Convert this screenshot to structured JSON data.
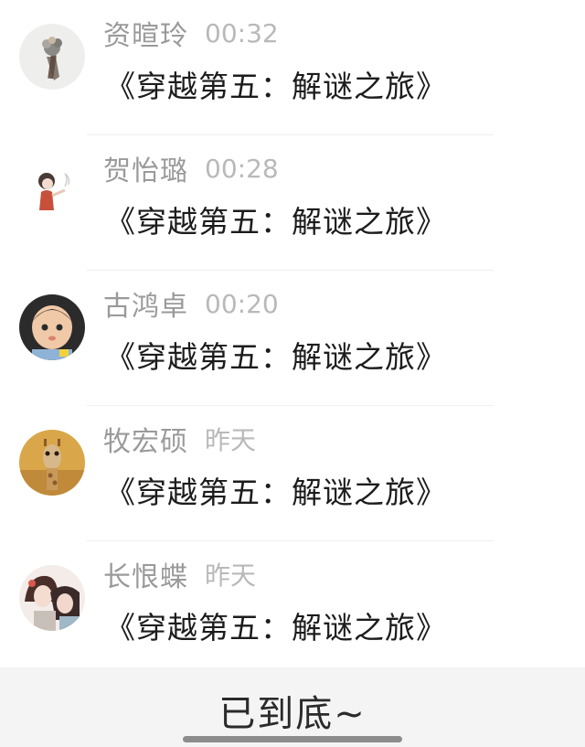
{
  "comments": [
    {
      "name": "资暄玲",
      "time": "00:32",
      "text": "《穿越第五：解谜之旅》",
      "avatar": "flower-bouquet-avatar"
    },
    {
      "name": "贺怡璐",
      "time": "00:28",
      "text": "《穿越第五：解谜之旅》",
      "avatar": "girl-illustration-avatar"
    },
    {
      "name": "古鸿卓",
      "time": "00:20",
      "text": "《穿越第五：解谜之旅》",
      "avatar": "baby-photo-avatar"
    },
    {
      "name": "牧宏硕",
      "time": "昨天",
      "text": "《穿越第五：解谜之旅》",
      "avatar": "giraffe-avatar"
    },
    {
      "name": "长恨蝶",
      "time": "昨天",
      "text": "《穿越第五：解谜之旅》",
      "avatar": "anime-couple-avatar"
    }
  ],
  "footer": {
    "end_text": "已到底~"
  },
  "colors": {
    "name": "#9a9a9a",
    "time": "#b9b9b9",
    "content": "#1c1c1c",
    "footer_bg": "#f4f4f4"
  }
}
